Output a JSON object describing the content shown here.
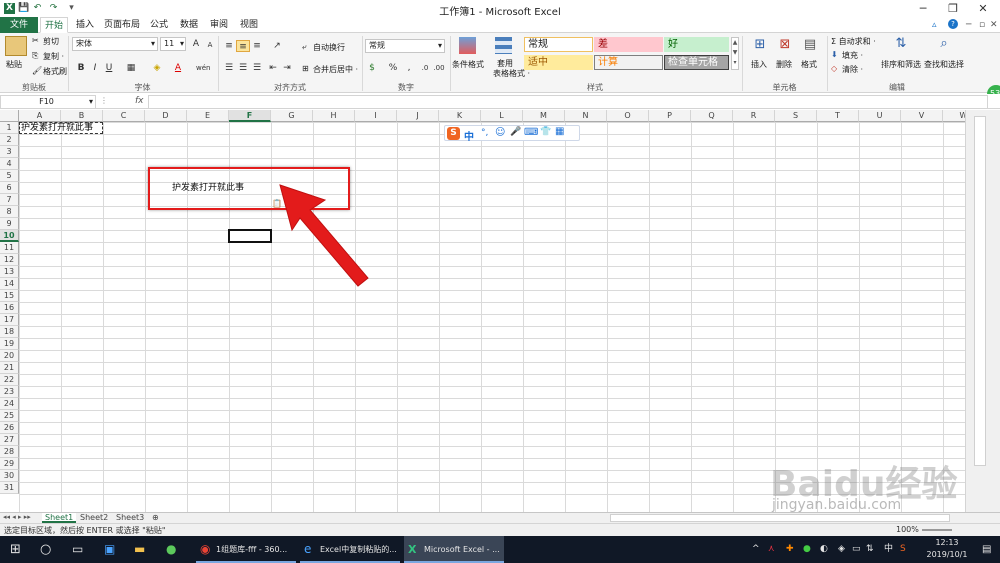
{
  "window": {
    "title": "工作簿1 - Microsoft Excel",
    "help": "?",
    "minimize": "─",
    "restore": "❐",
    "close": "✕"
  },
  "quick_access": {
    "save": "💾",
    "undo": "↶",
    "redo": "↷",
    "more": "▾"
  },
  "tabs": [
    "文件",
    "开始",
    "插入",
    "页面布局",
    "公式",
    "数据",
    "审阅",
    "视图"
  ],
  "ribbon": {
    "clipboard": {
      "label": "剪贴板",
      "paste": "粘贴",
      "cut": "剪切",
      "copy": "复制 ·",
      "format_painter": "格式刷"
    },
    "font": {
      "label": "字体",
      "name": "宋体",
      "size": "11",
      "bold": "B",
      "italic": "I",
      "underline": "U",
      "grow": "A",
      "shrink": "A",
      "wen": "wén"
    },
    "alignment": {
      "label": "对齐方式",
      "wrap": "自动换行",
      "merge": "合并后居中 ·"
    },
    "number": {
      "label": "数字",
      "format": "常规",
      "percent": "%",
      "comma": ","
    },
    "styles": {
      "label": "样式",
      "conditional": "条件格式",
      "table_fmt": "套用\n表格格式 ·",
      "cells": [
        {
          "text": "常规",
          "bg": "#ffffff",
          "fg": "#222222",
          "border": "#f0c060"
        },
        {
          "text": "差",
          "bg": "#ffc7ce",
          "fg": "#9c0006",
          "border": "#ffc7ce"
        },
        {
          "text": "好",
          "bg": "#c6efce",
          "fg": "#006100",
          "border": "#c6efce"
        },
        {
          "text": "适中",
          "bg": "#ffeb9c",
          "fg": "#9c5700",
          "border": "#ffeb9c"
        },
        {
          "text": "计算",
          "bg": "#f2f2f2",
          "fg": "#fa7d00",
          "border": "#7f7f7f"
        },
        {
          "text": "检查单元格",
          "bg": "#a5a5a5",
          "fg": "#ffffff",
          "border": "#3f3f3f"
        }
      ]
    },
    "cells_group": {
      "label": "单元格",
      "insert": "插入",
      "delete": "删除",
      "format": "格式"
    },
    "editing": {
      "label": "编辑",
      "autosum": "Σ 自动求和 ·",
      "fill": "填充 ·",
      "clear": "清除 ·",
      "sort": "排序和筛选",
      "find": "查找和选择"
    }
  },
  "formula_bar": {
    "name_box": "F10",
    "fx": "fx",
    "value": ""
  },
  "columns": [
    "A",
    "B",
    "C",
    "D",
    "E",
    "F",
    "G",
    "H",
    "I",
    "J",
    "K",
    "L",
    "M",
    "N",
    "O",
    "P",
    "Q",
    "R",
    "S",
    "T",
    "U",
    "V",
    "W"
  ],
  "row_count": 31,
  "selected": {
    "col": "F",
    "row": 10
  },
  "cells": [
    {
      "ref": "A1",
      "text": "护发素打开就此事"
    },
    {
      "ref": "D6",
      "text": "护发素打开就此事"
    }
  ],
  "ime_toolbar": {
    "logo": "S",
    "lang": "中",
    "items": [
      "°,",
      "☺",
      "🎤",
      "⌨",
      "👕",
      "▦"
    ]
  },
  "sheets": [
    "Sheet1",
    "Sheet2",
    "Sheet3"
  ],
  "status": {
    "message": "选定目标区域，然后按 ENTER 或选择 \"粘贴\"",
    "zoom": "100%"
  },
  "side_badge": "53",
  "watermark": {
    "brand": "Baidu经验",
    "url": "jingyan.baidu.com"
  },
  "taskbar": {
    "items": [
      "1组题库-fff - 360...",
      "Excel中复制粘贴的...",
      "Microsoft Excel - ..."
    ],
    "tray": {
      "lang": "中",
      "time": "12:13",
      "date": "2019/10/1"
    }
  },
  "colors": {
    "excel_green": "#217346",
    "annotation_red": "#e31b1b",
    "taskbar": "#101826"
  }
}
